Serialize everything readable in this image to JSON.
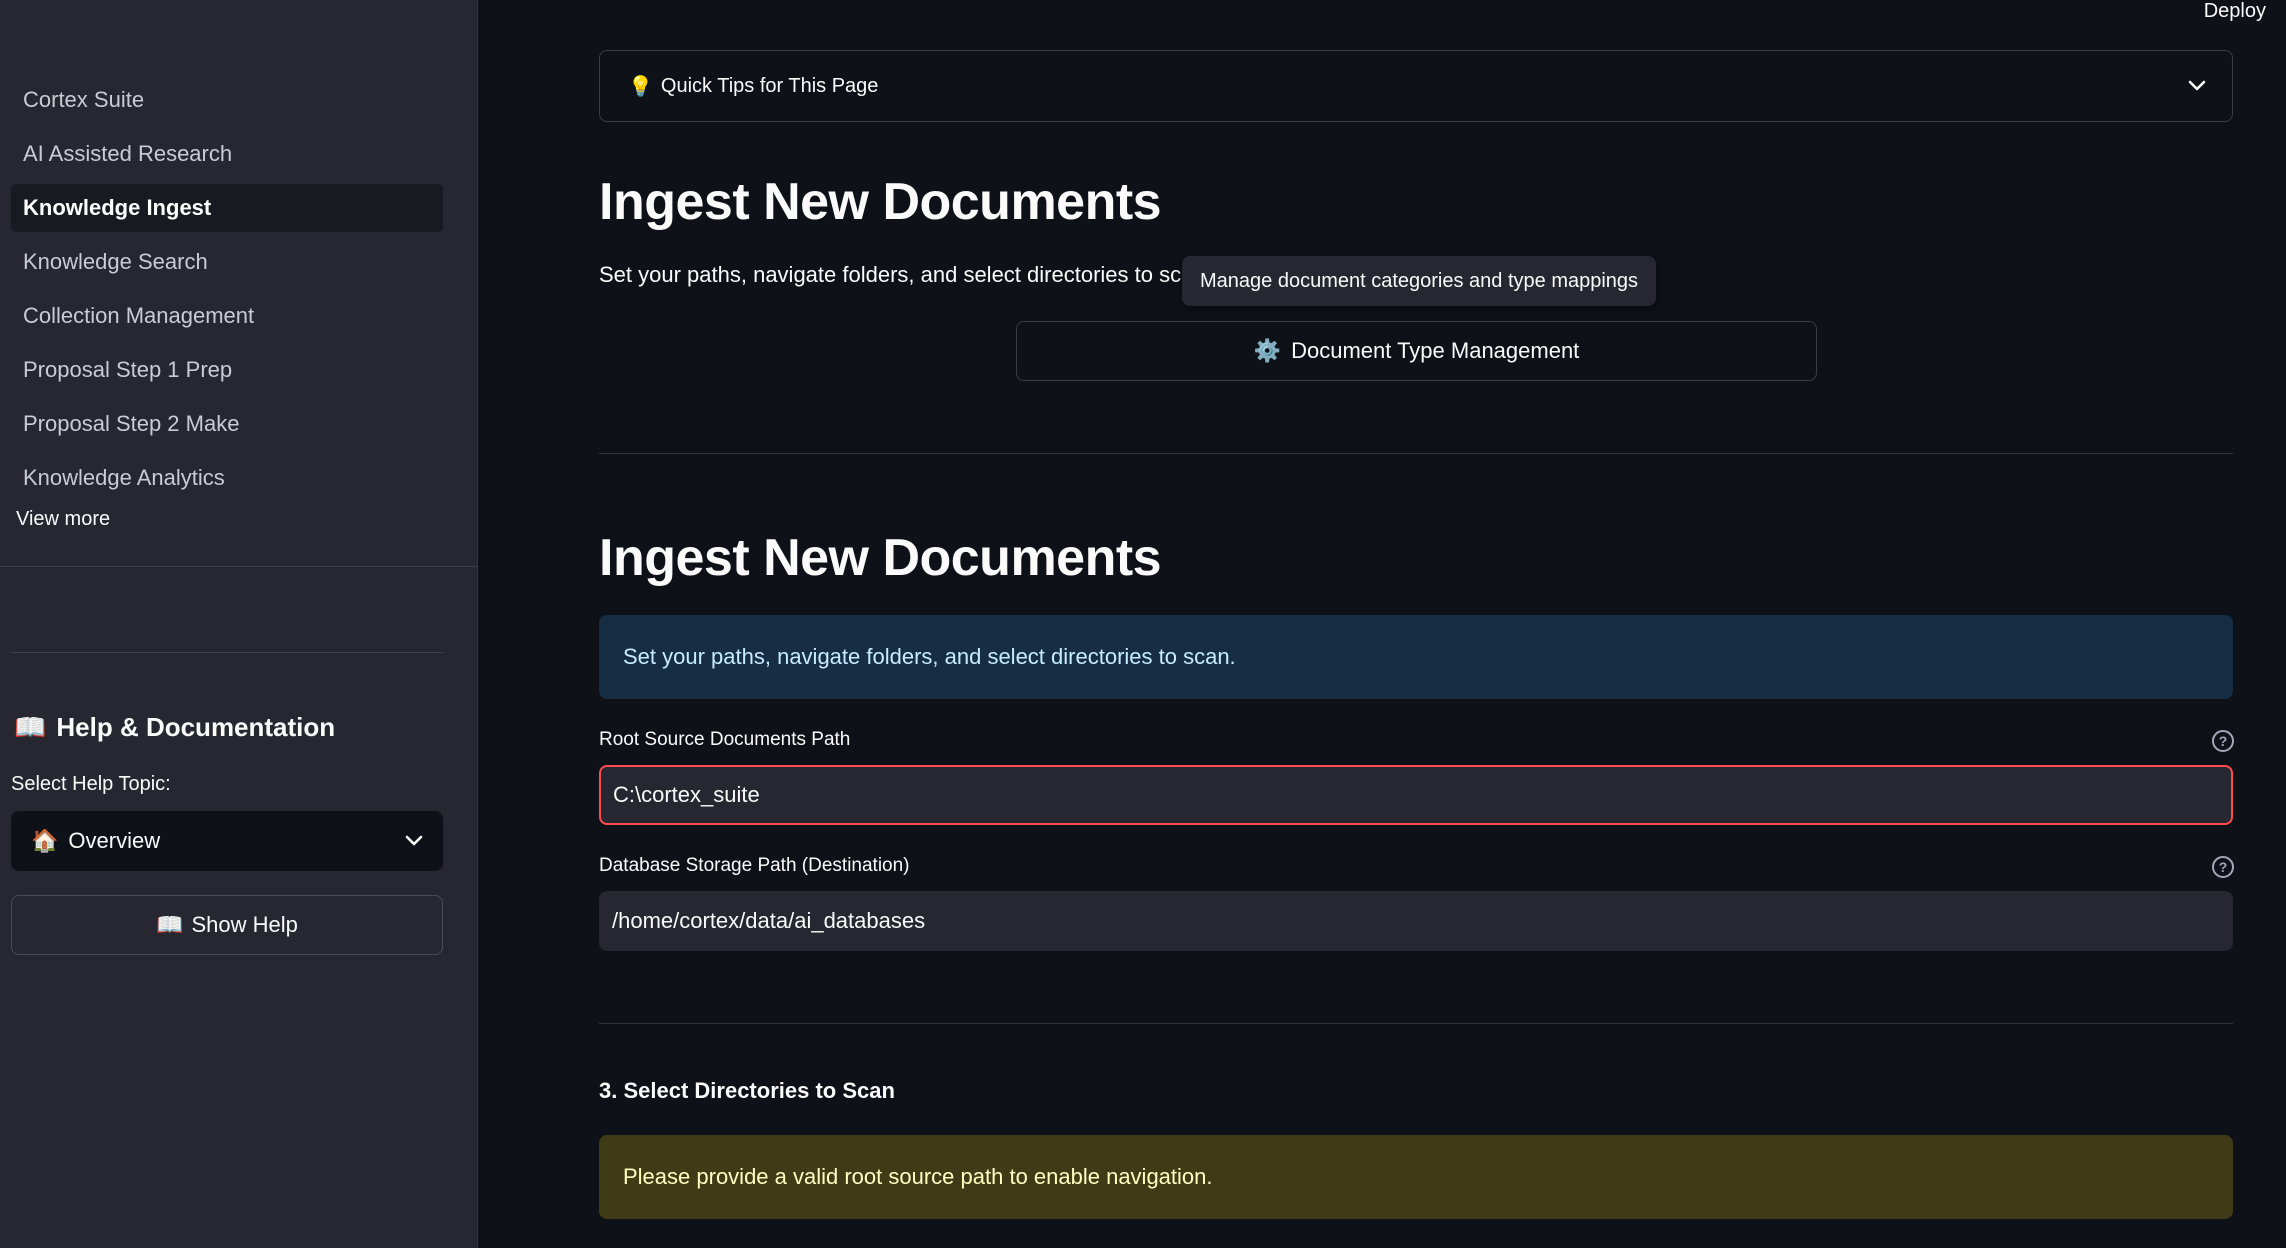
{
  "sidebar": {
    "nav": [
      {
        "label": "Cortex Suite",
        "active": false
      },
      {
        "label": "AI Assisted Research",
        "active": false
      },
      {
        "label": "Knowledge Ingest",
        "active": true
      },
      {
        "label": "Knowledge Search",
        "active": false
      },
      {
        "label": "Collection Management",
        "active": false
      },
      {
        "label": "Proposal Step 1 Prep",
        "active": false
      },
      {
        "label": "Proposal Step 2 Make",
        "active": false
      },
      {
        "label": "Knowledge Analytics",
        "active": false
      }
    ],
    "view_more": "View more",
    "help": {
      "icon": "📖",
      "title": "Help & Documentation",
      "select_label": "Select Help Topic:",
      "selected_icon": "🏠",
      "selected_topic": "Overview",
      "show_button_icon": "📖",
      "show_button": "Show Help"
    }
  },
  "header": {
    "deploy": "Deploy"
  },
  "main": {
    "tips": {
      "icon": "💡",
      "label": "Quick Tips for This Page"
    },
    "title_1": "Ingest New Documents",
    "intro_text": "Set your paths, navigate folders, and select directories to sc",
    "tooltip": "Manage document categories and type mappings",
    "doc_type_button": {
      "icon": "⚙️",
      "label": "Document Type Management"
    },
    "title_2": "Ingest New Documents",
    "info_box": "Set your paths, navigate folders, and select directories to scan.",
    "root_path": {
      "label": "Root Source Documents Path",
      "value": "C:\\cortex_suite",
      "help": "?"
    },
    "db_path": {
      "label": "Database Storage Path (Destination)",
      "value": "/home/cortex/data/ai_databases",
      "help": "?"
    },
    "section_3": "3. Select Directories to Scan",
    "warning": "Please provide a valid root source path to enable navigation."
  },
  "colors": {
    "background": "#0e1117",
    "sidebar": "#262730",
    "info_bg": "#172d43",
    "warning_bg": "#3e3b16",
    "error_border": "#ff4b4b"
  }
}
